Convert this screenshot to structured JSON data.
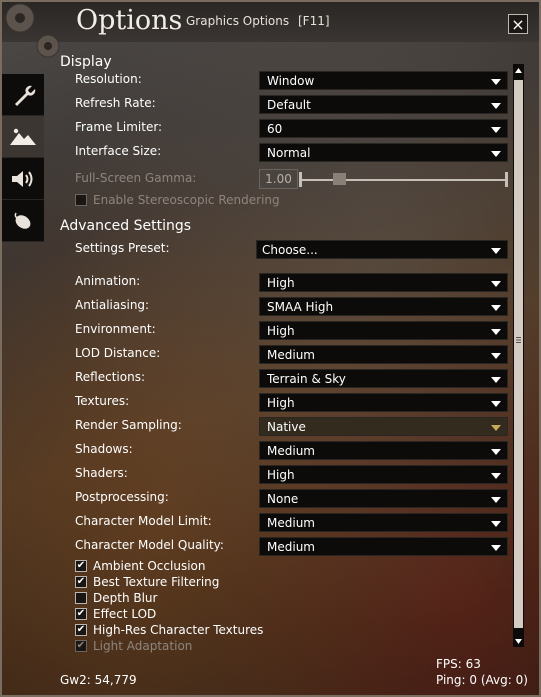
{
  "window": {
    "title": "Options",
    "subtitle": "Graphics Options",
    "hotkey": "[F11]",
    "close": "×"
  },
  "side_tabs": [
    "wrench-icon",
    "landscape-icon",
    "speaker-icon",
    "mouse-icon"
  ],
  "display": {
    "title": "Display",
    "rows": [
      {
        "label": "Resolution:",
        "value": "Window"
      },
      {
        "label": "Refresh Rate:",
        "value": "Default"
      },
      {
        "label": "Frame Limiter:",
        "value": "60"
      },
      {
        "label": "Interface Size:",
        "value": "Normal"
      }
    ],
    "gamma": {
      "label": "Full-Screen Gamma:",
      "value": "1.00",
      "level": 0.18
    },
    "stereo": {
      "label": "Enable Stereoscopic Rendering",
      "checked": false
    }
  },
  "advanced": {
    "title": "Advanced Settings",
    "preset": {
      "label": "Settings Preset:",
      "value": "Choose..."
    },
    "rows": [
      {
        "label": "Animation:",
        "value": "High"
      },
      {
        "label": "Antialiasing:",
        "value": "SMAA High"
      },
      {
        "label": "Environment:",
        "value": "High"
      },
      {
        "label": "LOD Distance:",
        "value": "Medium"
      },
      {
        "label": "Reflections:",
        "value": "Terrain & Sky"
      },
      {
        "label": "Textures:",
        "value": "High"
      },
      {
        "label": "Render Sampling:",
        "value": "Native"
      },
      {
        "label": "Shadows:",
        "value": "Medium"
      },
      {
        "label": "Shaders:",
        "value": "High"
      },
      {
        "label": "Postprocessing:",
        "value": "None"
      },
      {
        "label": "Character Model Limit:",
        "value": "Medium"
      },
      {
        "label": "Character Model Quality:",
        "value": "Medium"
      }
    ],
    "checkboxes": [
      {
        "label": "Ambient Occlusion",
        "checked": true
      },
      {
        "label": "Best Texture Filtering",
        "checked": true
      },
      {
        "label": "Depth Blur",
        "checked": false
      },
      {
        "label": "Effect LOD",
        "checked": true
      },
      {
        "label": "High-Res Character Textures",
        "checked": true
      },
      {
        "label": "Light Adaptation",
        "checked": true
      }
    ]
  },
  "footer": {
    "build": "Gw2: 54,779",
    "fps": "FPS: 63",
    "ping": "Ping: 0 (Avg: 0)"
  }
}
